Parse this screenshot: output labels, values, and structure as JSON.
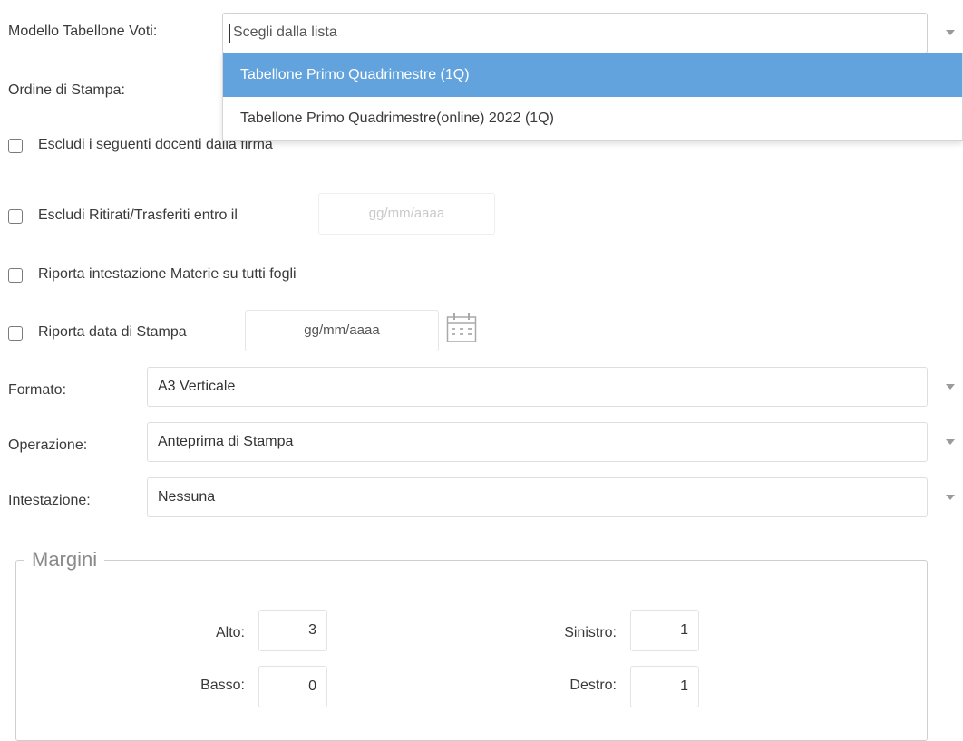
{
  "modello": {
    "label": "Modello Tabellone Voti:",
    "placeholder": "Scegli dalla lista",
    "options": [
      "Tabellone Primo Quadrimestre (1Q)",
      "Tabellone Primo Quadrimestre(online) 2022 (1Q)"
    ]
  },
  "ordine": {
    "label": "Ordine di Stampa:"
  },
  "checkboxes": {
    "escludi_docenti": "Escludi i seguenti docenti dalla firma",
    "escludi_ritirati": "Escludi Ritirati/Trasferiti entro il",
    "riporta_intestazione": "Riporta intestazione Materie su tutti fogli",
    "riporta_data": "Riporta data di Stampa"
  },
  "date_placeholder": "gg/mm/aaaa",
  "formato": {
    "label": "Formato:",
    "value": "A3 Verticale"
  },
  "operazione": {
    "label": "Operazione:",
    "value": "Anteprima di Stampa"
  },
  "intestazione": {
    "label": "Intestazione:",
    "value": "Nessuna"
  },
  "margini": {
    "title": "Margini",
    "alto": {
      "label": "Alto:",
      "value": "3"
    },
    "basso": {
      "label": "Basso:",
      "value": "0"
    },
    "sinistro": {
      "label": "Sinistro:",
      "value": "1"
    },
    "destro": {
      "label": "Destro:",
      "value": "1"
    }
  },
  "colors": {
    "highlight": "#62a3dd",
    "border": "#dedede"
  },
  "icons": {
    "calendar": "calendar-icon",
    "dropdown": "chevron-down-icon"
  }
}
